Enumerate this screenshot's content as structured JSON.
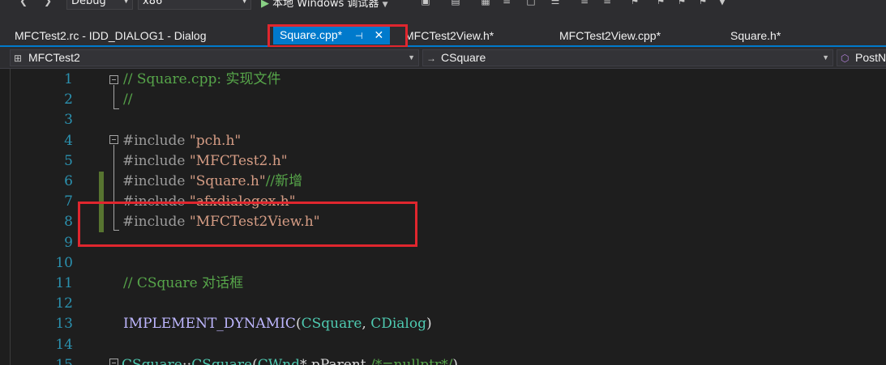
{
  "toolbar": {
    "config": "Debug",
    "platform": "x86",
    "run_label": "本地 Windows 调试器"
  },
  "tabs": [
    {
      "label": "MFCTest2.rc - IDD_DIALOG1 - Dialog",
      "active": false
    },
    {
      "label": "Square.cpp*",
      "active": true
    },
    {
      "label": "MFCTest2View.h*",
      "active": false
    },
    {
      "label": "MFCTest2View.cpp*",
      "active": false
    },
    {
      "label": "Square.h*",
      "active": false
    }
  ],
  "active_tab_icons": {
    "pin": "pin-icon",
    "close": "close-icon"
  },
  "navbar": {
    "project": "MFCTest2",
    "class": "CSquare",
    "member": "PostN"
  },
  "editor": {
    "line_numbers": [
      "1",
      "2",
      "3",
      "4",
      "5",
      "6",
      "7",
      "8",
      "9",
      "10",
      "11",
      "12",
      "13",
      "14",
      "15"
    ],
    "lines": [
      {
        "n": "1",
        "parts": [
          [
            "c-comment",
            "// Square.cpp: 实现文件"
          ]
        ]
      },
      {
        "n": "2",
        "parts": [
          [
            "c-comment",
            "//"
          ]
        ]
      },
      {
        "n": "3",
        "parts": []
      },
      {
        "n": "4",
        "parts": [
          [
            "c-pre",
            "#include "
          ],
          [
            "c-str",
            "\"pch.h\""
          ]
        ]
      },
      {
        "n": "5",
        "parts": [
          [
            "c-pre",
            "#include "
          ],
          [
            "c-str",
            "\"MFCTest2.h\""
          ]
        ]
      },
      {
        "n": "6",
        "parts": [
          [
            "c-pre",
            "#include "
          ],
          [
            "c-str",
            "\"Square.h\""
          ],
          [
            "c-comment",
            "//新增"
          ]
        ]
      },
      {
        "n": "7",
        "parts": [
          [
            "c-pre",
            "#include "
          ],
          [
            "c-str",
            "\"afxdialogex.h\""
          ]
        ]
      },
      {
        "n": "8",
        "parts": [
          [
            "c-pre",
            "#include "
          ],
          [
            "c-str",
            "\"MFCTest2View.h\""
          ]
        ]
      },
      {
        "n": "9",
        "parts": []
      },
      {
        "n": "10",
        "parts": []
      },
      {
        "n": "11",
        "parts": [
          [
            "c-comment",
            "// CSquare 对话框"
          ]
        ]
      },
      {
        "n": "12",
        "parts": []
      },
      {
        "n": "13",
        "parts": [
          [
            "c-macro",
            "IMPLEMENT_DYNAMIC"
          ],
          [
            "c-plain",
            "("
          ],
          [
            "c-type",
            "CSquare"
          ],
          [
            "c-plain",
            ", "
          ],
          [
            "c-type",
            "CDialog"
          ],
          [
            "c-plain",
            ")"
          ]
        ]
      },
      {
        "n": "14",
        "parts": []
      },
      {
        "n": "15",
        "parts": [
          [
            "c-type",
            "CSquare"
          ],
          [
            "c-plain",
            "::"
          ],
          [
            "c-type",
            "CSquare"
          ],
          [
            "c-plain",
            "("
          ],
          [
            "c-type",
            "CWnd"
          ],
          [
            "c-plain",
            "* pParent "
          ],
          [
            "c-comment",
            "/*=nullptr*/"
          ],
          [
            "c-plain",
            ")"
          ]
        ]
      }
    ]
  },
  "colors": {
    "accent": "#007acc",
    "highlight_box": "#e0262e",
    "change_bar": "#577430"
  }
}
